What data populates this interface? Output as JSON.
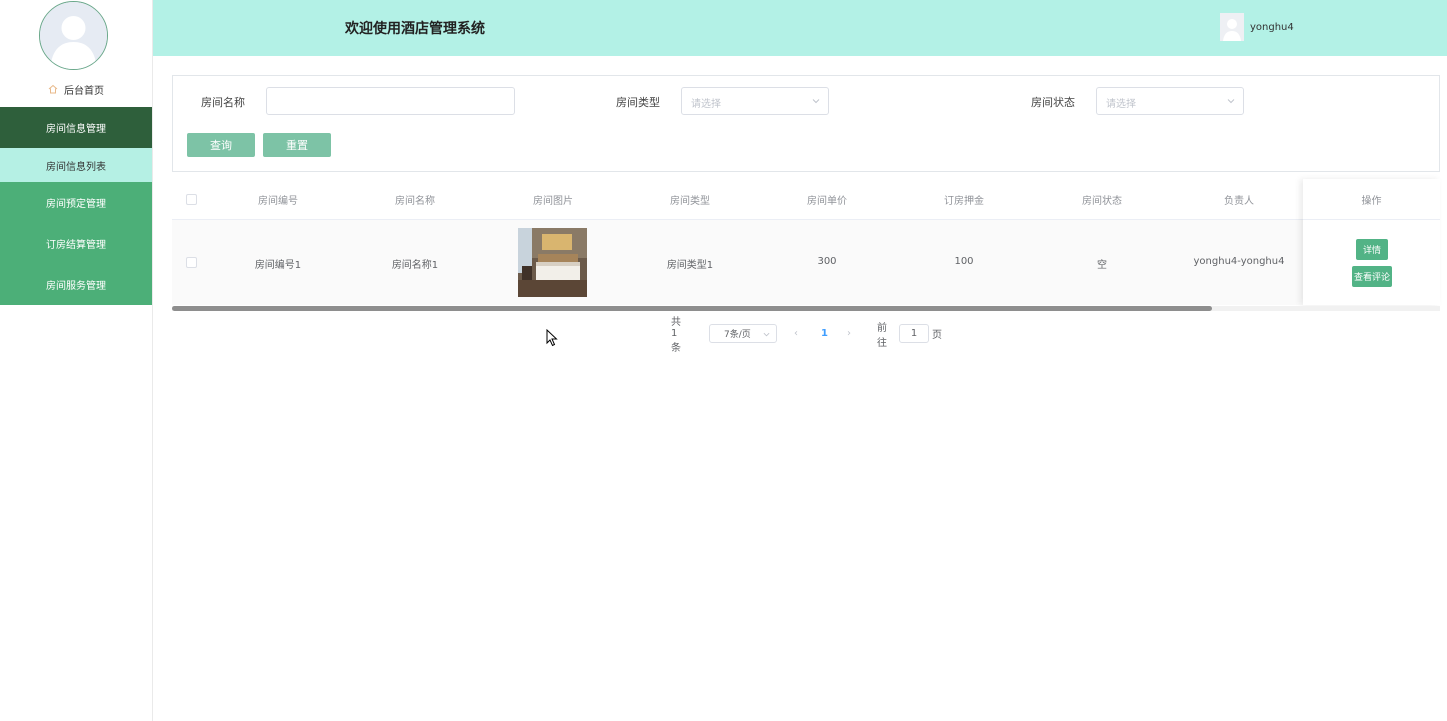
{
  "header": {
    "title": "欢迎使用酒店管理系统",
    "username": "yonghu4"
  },
  "sidebar": {
    "home_label": "后台首页",
    "items": [
      {
        "label": "房间信息管理",
        "active": true
      },
      {
        "label": "房间信息列表",
        "sub": true
      },
      {
        "label": "房间预定管理"
      },
      {
        "label": "订房结算管理"
      },
      {
        "label": "房间服务管理"
      }
    ]
  },
  "search": {
    "room_name_label": "房间名称",
    "room_name_value": "",
    "room_type_label": "房间类型",
    "room_type_placeholder": "请选择",
    "room_status_label": "房间状态",
    "room_status_placeholder": "请选择",
    "query_label": "查询",
    "reset_label": "重置"
  },
  "table": {
    "columns": [
      "房间编号",
      "房间名称",
      "房间图片",
      "房间类型",
      "房间单价",
      "订房押金",
      "房间状态",
      "负责人",
      "操作"
    ],
    "rows": [
      {
        "room_no": "房间编号1",
        "room_name": "房间名称1",
        "room_type": "房间类型1",
        "price": "300",
        "deposit": "100",
        "status": "空",
        "manager": "yonghu4-yonghu4",
        "actions": {
          "detail": "详情",
          "view_comments": "查看评论"
        }
      }
    ]
  },
  "pagination": {
    "total": "共 1 条",
    "page_size": "7条/页",
    "prev": "‹",
    "current_page": "1",
    "next": "›",
    "goto_label": "前往",
    "goto_value": "1",
    "page_suffix": "页"
  },
  "colors": {
    "header_bg": "#b3f1e6",
    "menu_bg": "#4caf78",
    "menu_active_bg": "#2e5f3b",
    "submenu_bg": "#b5f0e4",
    "button_bg": "#7dc3a6",
    "action_button_bg": "#52b386"
  }
}
